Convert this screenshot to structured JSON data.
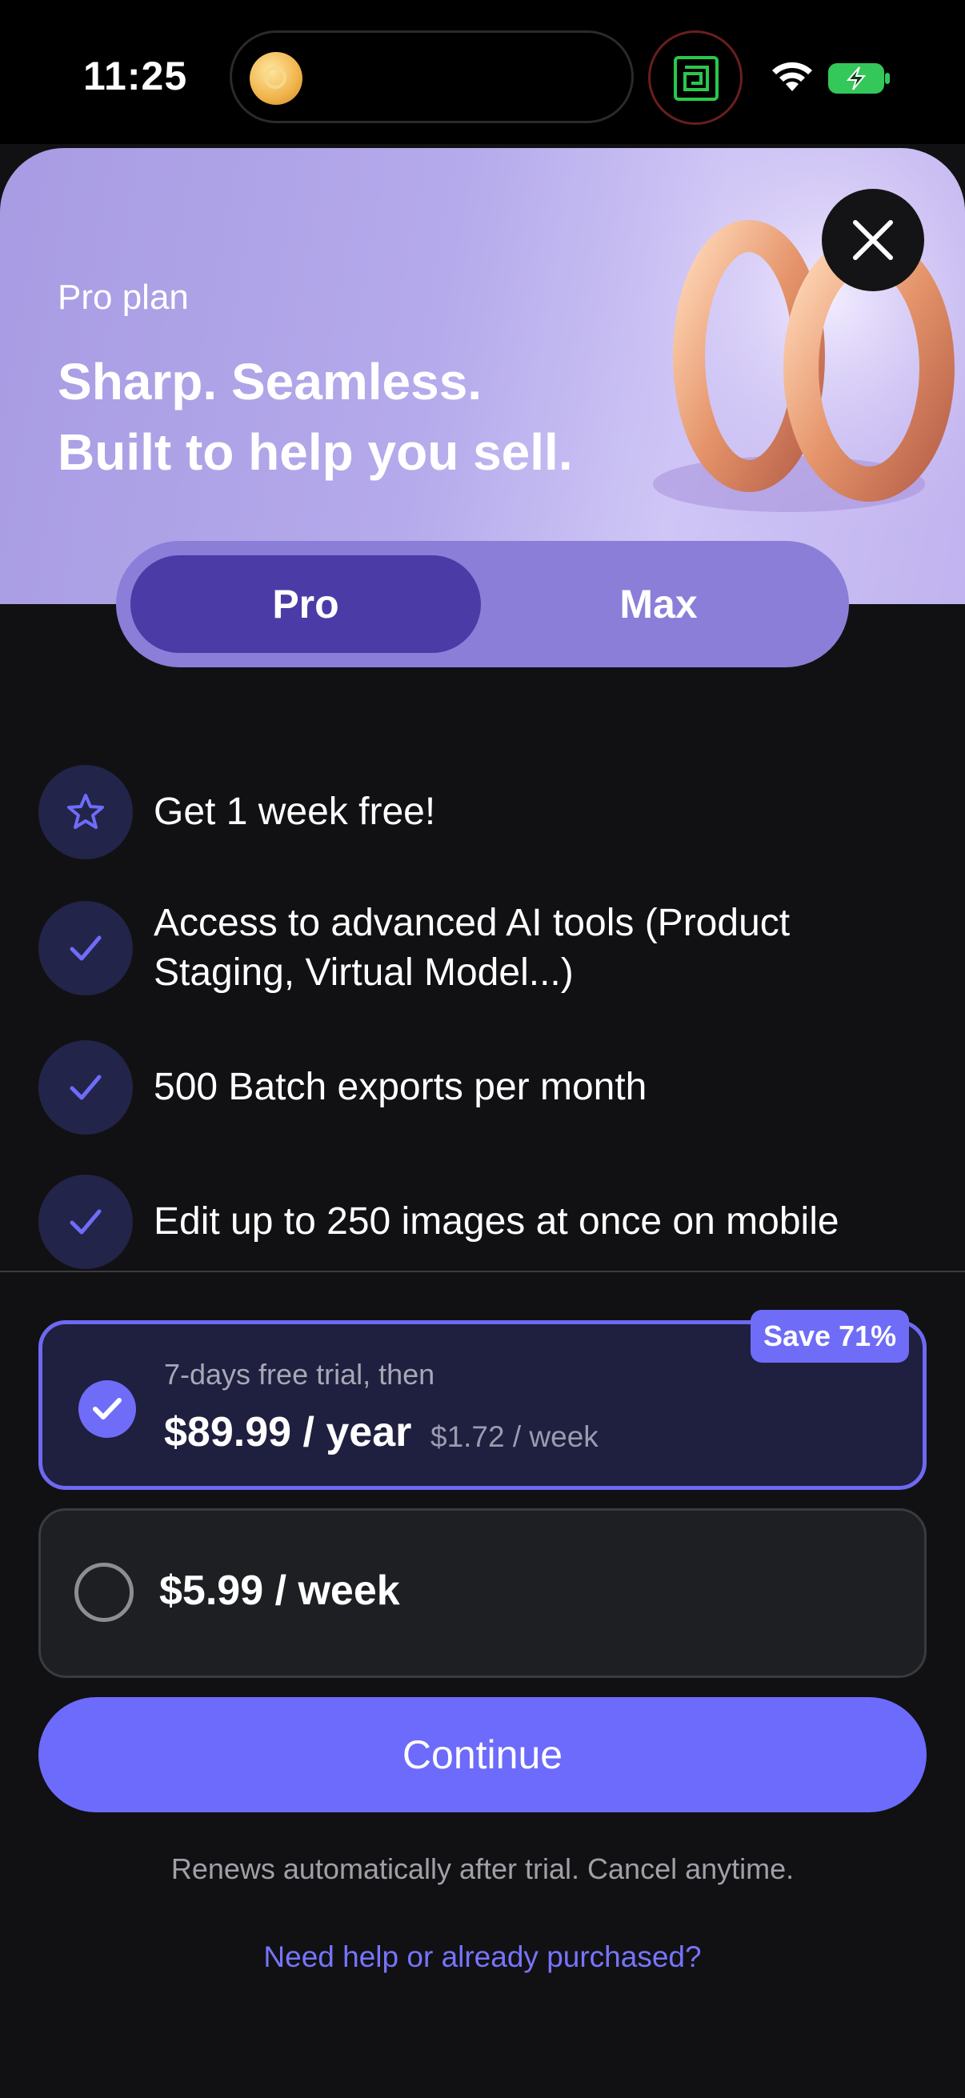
{
  "status_bar": {
    "time": "11:25"
  },
  "hero": {
    "subtitle": "Pro plan",
    "title_line1": "Sharp. Seamless.",
    "title_line2": "Built to help you sell."
  },
  "plan_tabs": [
    {
      "label": "Pro",
      "selected": true
    },
    {
      "label": "Max",
      "selected": false
    }
  ],
  "features": [
    {
      "icon": "star-icon",
      "line1": "Get 1 week free!",
      "line2": ""
    },
    {
      "icon": "check-icon",
      "line1": "Access to advanced AI tools (Product",
      "line2": "Staging, Virtual Model...)"
    },
    {
      "icon": "check-icon",
      "line1": "500 Batch exports per month",
      "line2": ""
    },
    {
      "icon": "check-icon",
      "line1": "Edit up to 250 images at once on mobile",
      "line2": ""
    }
  ],
  "plans": {
    "yearly": {
      "badge": "Save 71%",
      "trial_text": "7-days free trial, then",
      "price": "$89.99 / year",
      "per_week": "$1.72 / week",
      "selected": true
    },
    "weekly": {
      "price": "$5.99 / week",
      "selected": false
    }
  },
  "cta": {
    "continue_label": "Continue"
  },
  "footer": {
    "renews_text": "Renews automatically after trial. Cancel anytime.",
    "help_link": "Need help or already purchased?"
  },
  "colors": {
    "accent": "#6d6bfb",
    "hero_bg": "#b5aaeb",
    "segment_selected": "#4b3ba6",
    "background": "#111113"
  }
}
